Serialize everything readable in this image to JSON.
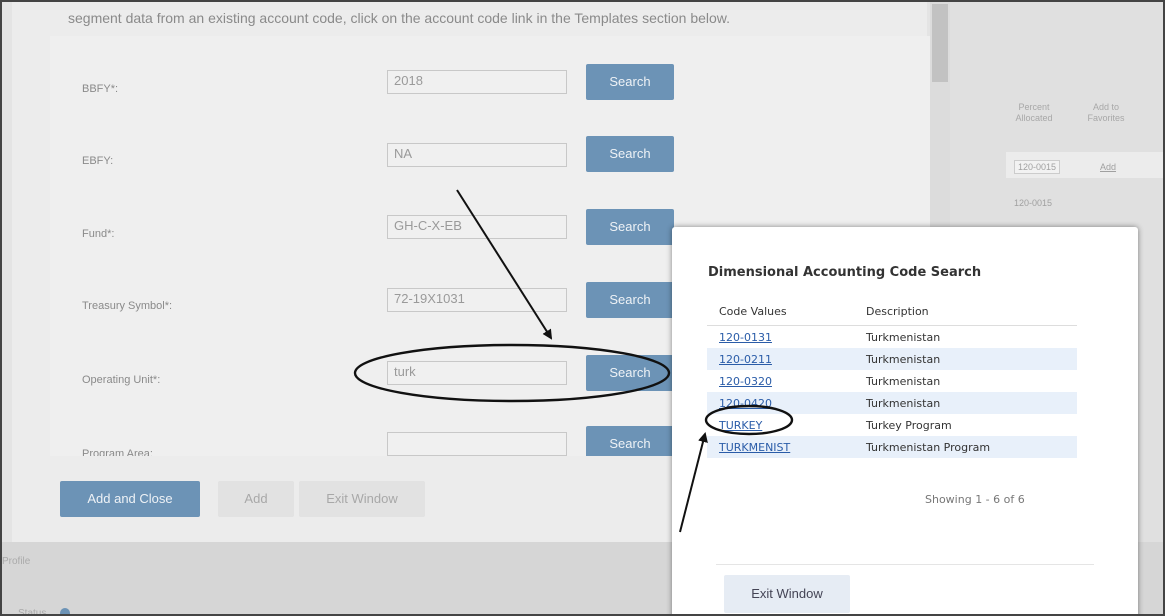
{
  "intro_text": "segment data from an existing account code, click on the account code link in the Templates section below.",
  "form": {
    "fields": [
      {
        "label": "BBFY*:",
        "value": "2018",
        "button": "Search"
      },
      {
        "label": "EBFY:",
        "value": "NA",
        "button": "Search"
      },
      {
        "label": "Fund*:",
        "value": "GH-C-X-EB",
        "button": "Search"
      },
      {
        "label": "Treasury Symbol*:",
        "value": "72-19X1031",
        "button": "Search"
      },
      {
        "label": "Operating Unit*:",
        "value": "turk",
        "button": "Search"
      },
      {
        "label": "Program Area:",
        "value": "",
        "button": "Search"
      }
    ],
    "add_close_label": "Add and Close",
    "add_label": "Add",
    "exit_label": "Exit Window"
  },
  "background_table": {
    "headers": [
      "Percent Allocated",
      "Add to Favorites"
    ],
    "row1": [
      "120-0015",
      "Add"
    ],
    "row2": [
      "120-0015"
    ]
  },
  "bottom": {
    "label1": "Profile",
    "label2": "Status"
  },
  "modal": {
    "title": "Dimensional Accounting Code Search",
    "col_code": "Code Values",
    "col_desc": "Description",
    "rows": [
      {
        "code": "120-0131",
        "desc": "Turkmenistan"
      },
      {
        "code": "120-0211",
        "desc": "Turkmenistan"
      },
      {
        "code": "120-0320",
        "desc": "Turkmenistan"
      },
      {
        "code": "120-0420",
        "desc": "Turkmenistan"
      },
      {
        "code": "TURKEY",
        "desc": "Turkey Program"
      },
      {
        "code": "TURKMENIST",
        "desc": "Turkmenistan Program"
      }
    ],
    "showing": "Showing 1 - 6 of 6",
    "exit_label": "Exit Window"
  },
  "colors": {
    "search_button": "#6c93b6",
    "link": "#2a5ca8",
    "row_highlight": "#e8f0fa"
  }
}
